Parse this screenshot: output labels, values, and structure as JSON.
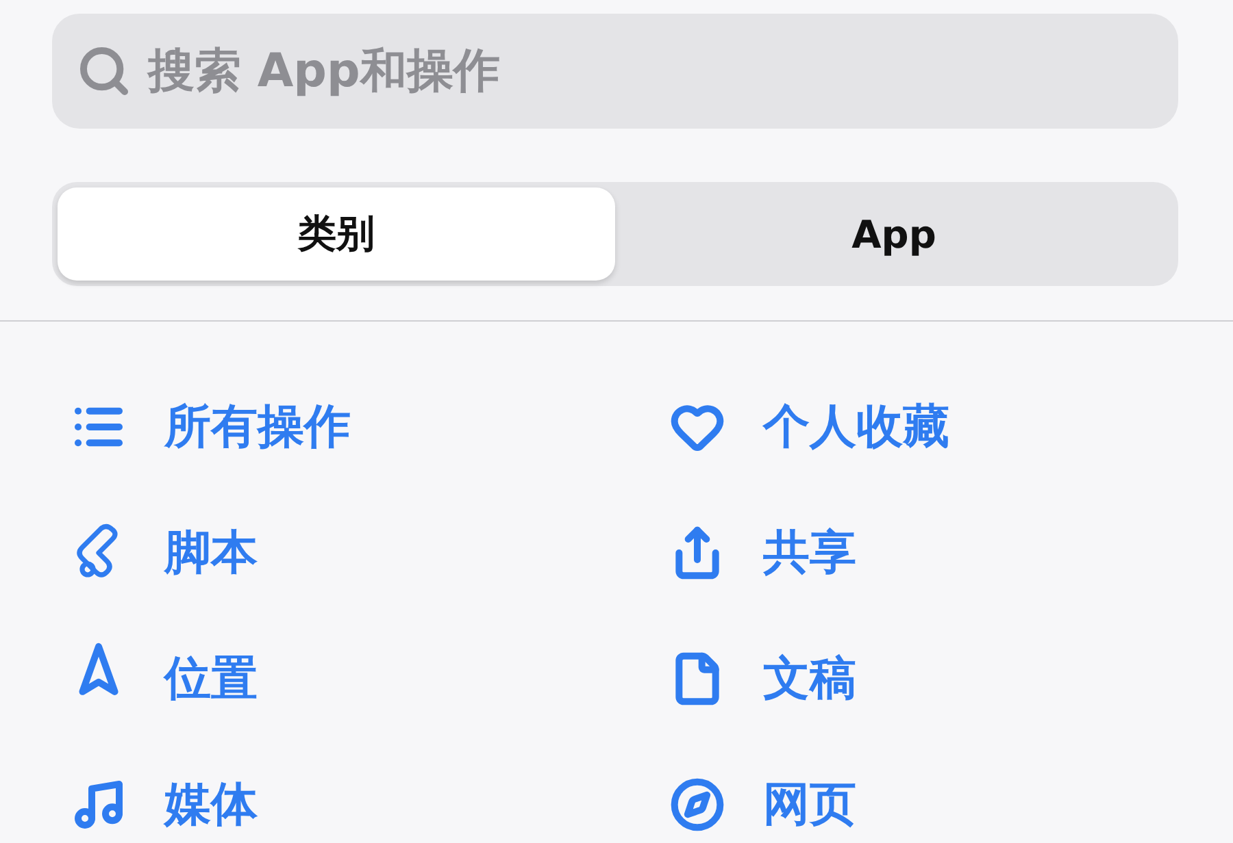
{
  "search": {
    "placeholder": "搜索 App和操作"
  },
  "segments": [
    {
      "label": "类别",
      "selected": true
    },
    {
      "label": "App",
      "selected": false
    }
  ],
  "categories": [
    {
      "label": "所有操作"
    },
    {
      "label": "个人收藏"
    },
    {
      "label": "脚本"
    },
    {
      "label": "共享"
    },
    {
      "label": "位置"
    },
    {
      "label": "文稿"
    },
    {
      "label": "媒体"
    },
    {
      "label": "网页"
    }
  ]
}
